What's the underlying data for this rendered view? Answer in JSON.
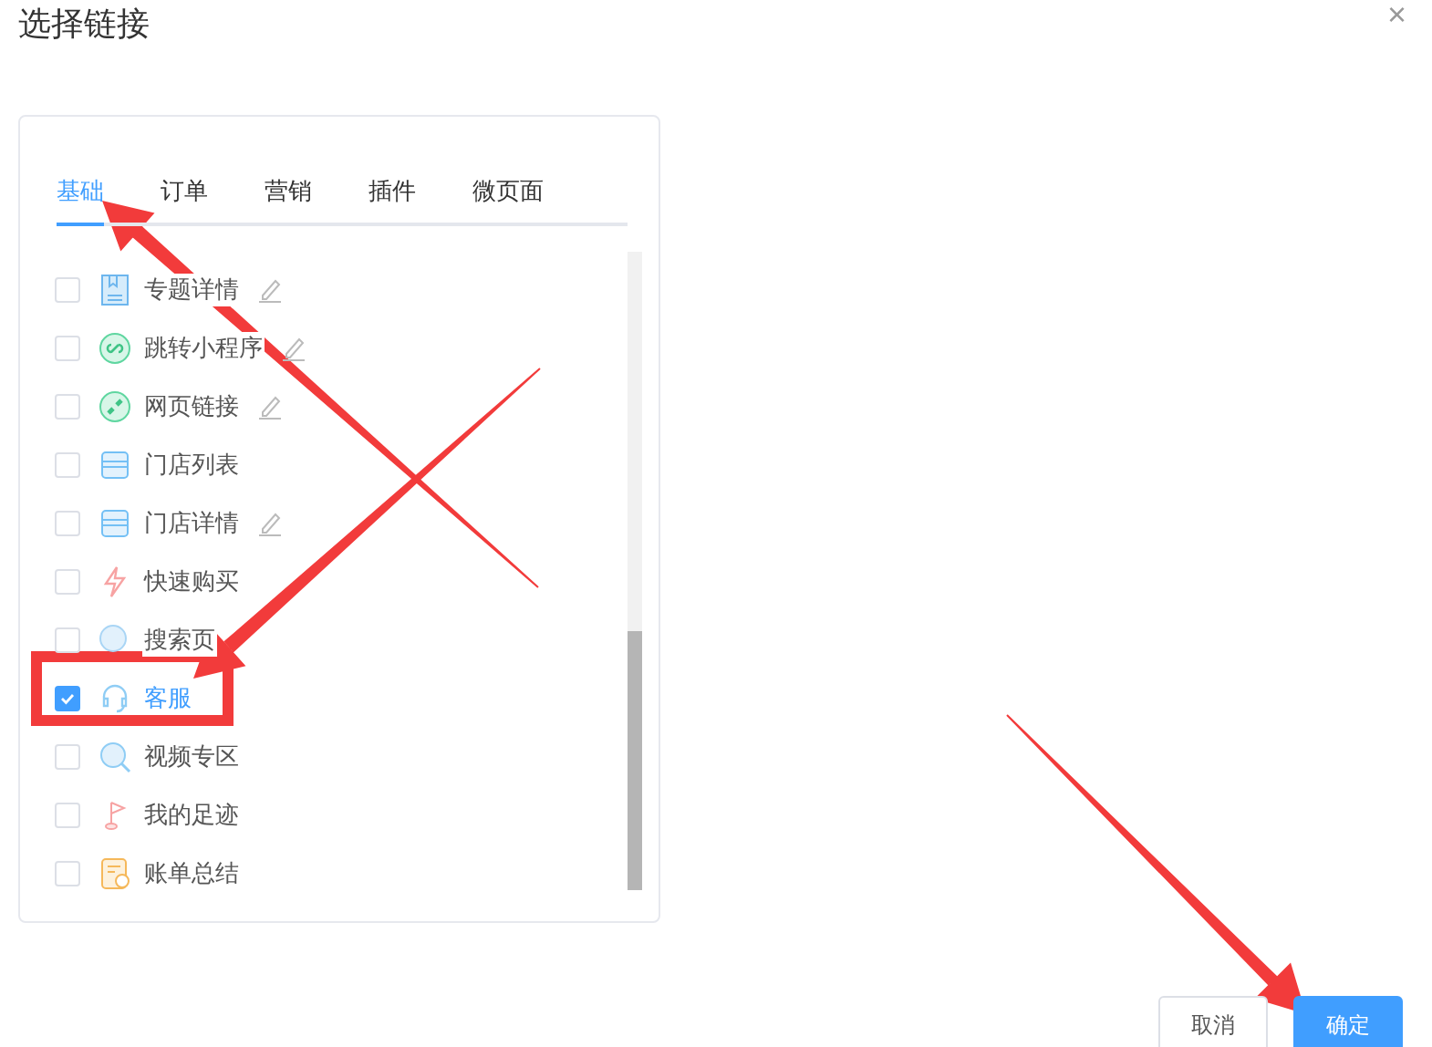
{
  "dialog": {
    "title": "选择链接",
    "close": "×"
  },
  "tabs": [
    {
      "label": "基础",
      "selected": true
    },
    {
      "label": "订单",
      "selected": false
    },
    {
      "label": "营销",
      "selected": false
    },
    {
      "label": "插件",
      "selected": false
    },
    {
      "label": "微页面",
      "selected": false
    }
  ],
  "items": [
    {
      "label": "专题详情",
      "kind": "topic",
      "editable": true,
      "checked": false
    },
    {
      "label": "跳转小程序",
      "kind": "miniprogram",
      "editable": true,
      "checked": false
    },
    {
      "label": "网页链接",
      "kind": "link",
      "editable": true,
      "checked": false
    },
    {
      "label": "门店列表",
      "kind": "store",
      "editable": false,
      "checked": false
    },
    {
      "label": "门店详情",
      "kind": "store",
      "editable": true,
      "checked": false
    },
    {
      "label": "快速购买",
      "kind": "flash",
      "editable": false,
      "checked": false
    },
    {
      "label": "搜索页",
      "kind": "search",
      "editable": false,
      "checked": false
    },
    {
      "label": "客服",
      "kind": "service",
      "editable": false,
      "checked": true
    },
    {
      "label": "视频专区",
      "kind": "video",
      "editable": false,
      "checked": false
    },
    {
      "label": "我的足迹",
      "kind": "footprint",
      "editable": false,
      "checked": false
    },
    {
      "label": "账单总结",
      "kind": "bill",
      "editable": false,
      "checked": false
    }
  ],
  "buttons": [
    {
      "label": "取消",
      "kind": "default"
    },
    {
      "label": "确定",
      "kind": "primary"
    }
  ]
}
